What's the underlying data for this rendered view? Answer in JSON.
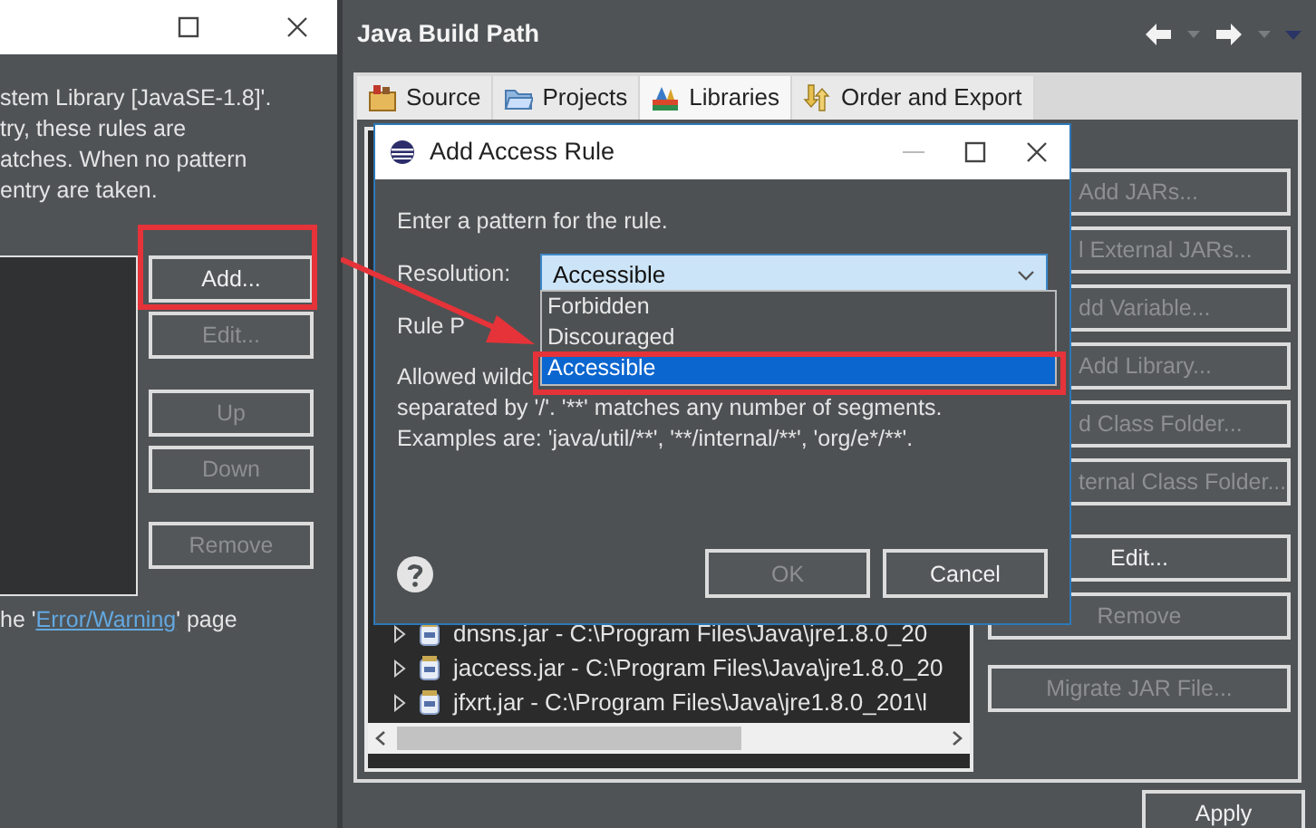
{
  "left_window": {
    "description_lines": [
      "stem Library [JavaSE-1.8]'.",
      "try, these rules are",
      "atches. When no pattern",
      "entry are taken."
    ],
    "buttons": [
      {
        "label": "Add...",
        "disabled": false
      },
      {
        "label": "Edit...",
        "disabled": true
      },
      {
        "label": "Up",
        "disabled": true
      },
      {
        "label": "Down",
        "disabled": true
      },
      {
        "label": "Remove",
        "disabled": true
      }
    ],
    "note": {
      "before": "he '",
      "link": "Error/Warning",
      "after": "' page"
    }
  },
  "main_window": {
    "title": "Java Build Path",
    "tabs": [
      {
        "label": "Source",
        "selected": false
      },
      {
        "label": "Projects",
        "selected": false
      },
      {
        "label": "Libraries",
        "selected": true
      },
      {
        "label": "Order and Export",
        "selected": false
      }
    ],
    "add_buttons": [
      {
        "label": "Add JARs...",
        "disabled": true
      },
      {
        "label": "l External JARs...",
        "disabled": true
      },
      {
        "label": "dd Variable...",
        "disabled": true
      },
      {
        "label": "Add Library...",
        "disabled": true
      },
      {
        "label": "d Class Folder...",
        "disabled": true
      },
      {
        "label": "ternal Class Folder...",
        "disabled": true
      }
    ],
    "other_buttons": [
      {
        "label": "Edit...",
        "disabled": false
      },
      {
        "label": "Remove",
        "disabled": true
      },
      {
        "label": "Migrate JAR File...",
        "disabled": true
      }
    ],
    "tree_rows": [
      "dnsns.jar - C:\\Program Files\\Java\\jre1.8.0_20",
      "jaccess.jar - C:\\Program Files\\Java\\jre1.8.0_20",
      "jfxrt.jar - C:\\Program Files\\Java\\jre1.8.0_201\\l"
    ],
    "apply": "Apply"
  },
  "dialog": {
    "title": "Add Access Rule",
    "prompt": "Enter a pattern for the rule.",
    "resolution_label": "Resolution:",
    "resolution_value": "Accessible",
    "options": [
      {
        "label": "Forbidden",
        "selected": false
      },
      {
        "label": "Discouraged",
        "selected": false
      },
      {
        "label": "Accessible",
        "selected": true
      }
    ],
    "rule_pattern_label": "Rule P",
    "help_lines": [
      "Allowed wildc",
      "separated by '/'. '**' matches any number of segments.",
      "Examples are: 'java/util/**', '**/internal/**', 'org/e*/**'."
    ],
    "ok": {
      "label": "OK",
      "disabled": true
    },
    "cancel": "Cancel"
  }
}
